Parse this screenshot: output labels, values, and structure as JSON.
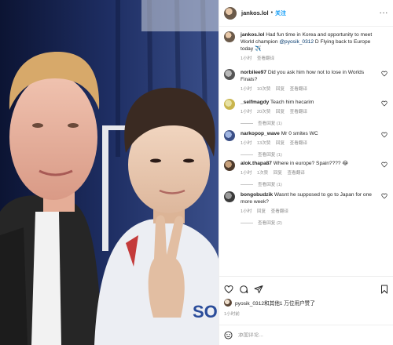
{
  "header": {
    "username": "jankos.lol",
    "separator": "•",
    "follow_label": "关注",
    "more_label": "···"
  },
  "caption": {
    "username": "jankos.lol",
    "text_before": "Had fun time in Korea and opportunity to meet World champion ",
    "mention": "@pyosik_0312",
    "text_after": " D Flying back to Europe today ✈️",
    "time": "1小时",
    "see_translation": "查看翻译"
  },
  "comments": [
    {
      "username": "norbilee97",
      "text": "Did you ask him how not to lose in Worlds Finals?",
      "time": "1小时",
      "likes": "10次赞",
      "reply": "回复",
      "translate": "查看翻译",
      "view_replies": ""
    },
    {
      "username": "_selfmagdy",
      "text": "Teach him hecarim",
      "time": "1小时",
      "likes": "20次赞",
      "reply": "回复",
      "translate": "查看翻译",
      "view_replies": "查看回复 (1)"
    },
    {
      "username": "narkopop_wave",
      "text": "Mr 0 smites WC",
      "time": "1小时",
      "likes": "13次赞",
      "reply": "回复",
      "translate": "查看翻译",
      "view_replies": "查看回复 (1)"
    },
    {
      "username": "alok.thapa87",
      "text": "Where in europe? Spain???? 😂",
      "time": "1小时",
      "likes": "1次赞",
      "reply": "回复",
      "translate": "查看翻译",
      "view_replies": "查看回复 (1)"
    },
    {
      "username": "bongobudzik",
      "text": "Wasnt he supposed to go to Japan for one more week?",
      "time": "1小时",
      "likes": "",
      "reply": "回复",
      "translate": "查看翻译",
      "view_replies": "查看回复 (2)"
    }
  ],
  "likes_line": "pyosik_0312和其他1 万位用户赞了",
  "post_time": "1小时前",
  "add_comment": {
    "placeholder": "添加评论..."
  },
  "icons": {
    "like": "heart-icon",
    "comment": "comment-icon",
    "share": "share-icon",
    "save": "bookmark-icon",
    "emoji": "emoji-icon"
  }
}
